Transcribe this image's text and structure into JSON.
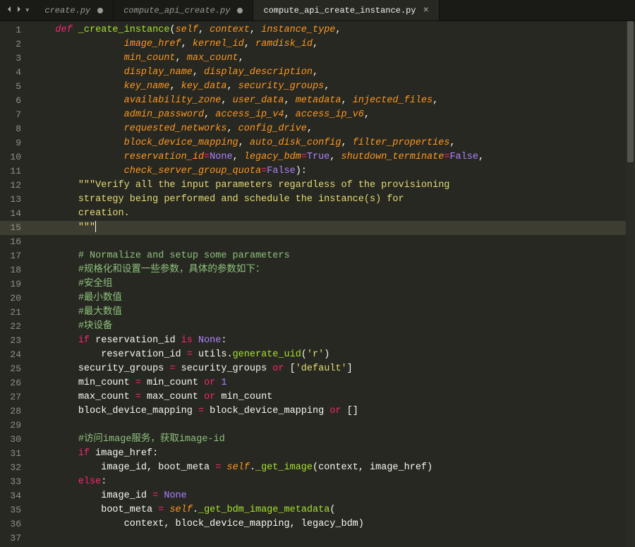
{
  "tabs": [
    {
      "label": "create.py",
      "modified": true,
      "active": false
    },
    {
      "label": "compute_api_create.py",
      "modified": true,
      "active": false
    },
    {
      "label": "compute_api_create_instance.py",
      "modified": false,
      "active": true
    }
  ],
  "line_start": 1,
  "line_end": 37,
  "current_line": 15,
  "code": {
    "l1": {
      "indent": "    ",
      "def": "def",
      "fname": "_create_instance",
      "open": "(",
      "p": [
        "self",
        "context",
        "instance_type"
      ],
      "trail": ","
    },
    "l2": {
      "indent": "                ",
      "p": [
        "image_href",
        "kernel_id",
        "ramdisk_id"
      ],
      "trail": ","
    },
    "l3": {
      "indent": "                ",
      "p": [
        "min_count",
        "max_count"
      ],
      "trail": ","
    },
    "l4": {
      "indent": "                ",
      "p": [
        "display_name",
        "display_description"
      ],
      "trail": ","
    },
    "l5": {
      "indent": "                ",
      "p": [
        "key_name",
        "key_data",
        "security_groups"
      ],
      "trail": ","
    },
    "l6": {
      "indent": "                ",
      "p": [
        "availability_zone",
        "user_data",
        "metadata",
        "injected_files"
      ],
      "trail": ","
    },
    "l7": {
      "indent": "                ",
      "p": [
        "admin_password",
        "access_ip_v4",
        "access_ip_v6"
      ],
      "trail": ","
    },
    "l8": {
      "indent": "                ",
      "p": [
        "requested_networks",
        "config_drive"
      ],
      "trail": ","
    },
    "l9": {
      "indent": "                ",
      "p": [
        "block_device_mapping",
        "auto_disk_config",
        "filter_properties"
      ],
      "trail": ","
    },
    "l10": {
      "indent": "                ",
      "kp": [
        [
          "reservation_id",
          "None"
        ],
        [
          "legacy_bdm",
          "True"
        ],
        [
          "shutdown_terminate",
          "False"
        ]
      ],
      "trail": ","
    },
    "l11": {
      "indent": "                ",
      "kp": [
        [
          "check_server_group_quota",
          "False"
        ]
      ],
      "close": "):"
    },
    "l12": {
      "indent": "        ",
      "doc": "\"\"\"Verify all the input parameters regardless of the provisioning"
    },
    "l13": {
      "indent": "        ",
      "doc": "strategy being performed and schedule the instance(s) for"
    },
    "l14": {
      "indent": "        ",
      "doc": "creation."
    },
    "l15": {
      "indent": "        ",
      "doc": "\"\"\""
    },
    "l16": {
      "blank": true
    },
    "l17": {
      "indent": "        ",
      "cmt": "# Normalize and setup some parameters"
    },
    "l18": {
      "indent": "        ",
      "cmt": "#规格化和设置一些参数，具体的参数如下："
    },
    "l19": {
      "indent": "        ",
      "cmt": "#安全组"
    },
    "l20": {
      "indent": "        ",
      "cmt": "#最小数值"
    },
    "l21": {
      "indent": "        ",
      "cmt": "#最大数值"
    },
    "l22": {
      "indent": "        ",
      "cmt": "#块设备"
    },
    "l23": {
      "indent": "        ",
      "tokens": [
        [
          "kw",
          "if"
        ],
        [
          "sp",
          " "
        ],
        [
          "t",
          "reservation_id"
        ],
        [
          "sp",
          " "
        ],
        [
          "kw",
          "is"
        ],
        [
          "sp",
          " "
        ],
        [
          "bool",
          "None"
        ],
        [
          "t",
          ":"
        ]
      ]
    },
    "l24": {
      "indent": "            ",
      "tokens": [
        [
          "t",
          "reservation_id "
        ],
        [
          "op",
          "="
        ],
        [
          "t",
          " utils."
        ],
        [
          "fn",
          "generate_uid"
        ],
        [
          "t",
          "("
        ],
        [
          "str",
          "'r'"
        ],
        [
          "t",
          ")"
        ]
      ]
    },
    "l25": {
      "indent": "        ",
      "tokens": [
        [
          "t",
          "security_groups "
        ],
        [
          "op",
          "="
        ],
        [
          "t",
          " security_groups "
        ],
        [
          "kw",
          "or"
        ],
        [
          "t",
          " ["
        ],
        [
          "str",
          "'default'"
        ],
        [
          "t",
          "]"
        ]
      ]
    },
    "l26": {
      "indent": "        ",
      "tokens": [
        [
          "t",
          "min_count "
        ],
        [
          "op",
          "="
        ],
        [
          "t",
          " min_count "
        ],
        [
          "kw",
          "or"
        ],
        [
          "sp",
          " "
        ],
        [
          "num",
          "1"
        ]
      ]
    },
    "l27": {
      "indent": "        ",
      "tokens": [
        [
          "t",
          "max_count "
        ],
        [
          "op",
          "="
        ],
        [
          "t",
          " max_count "
        ],
        [
          "kw",
          "or"
        ],
        [
          "t",
          " min_count"
        ]
      ]
    },
    "l28": {
      "indent": "        ",
      "tokens": [
        [
          "t",
          "block_device_mapping "
        ],
        [
          "op",
          "="
        ],
        [
          "t",
          " block_device_mapping "
        ],
        [
          "kw",
          "or"
        ],
        [
          "t",
          " []"
        ]
      ]
    },
    "l29": {
      "blank": true
    },
    "l30": {
      "indent": "        ",
      "cmt": "#访问image服务，获取image-id"
    },
    "l31": {
      "indent": "        ",
      "tokens": [
        [
          "kw",
          "if"
        ],
        [
          "t",
          " image_href:"
        ]
      ]
    },
    "l32": {
      "indent": "            ",
      "tokens": [
        [
          "t",
          "image_id, boot_meta "
        ],
        [
          "op",
          "="
        ],
        [
          "sp",
          " "
        ],
        [
          "self",
          "self"
        ],
        [
          "t",
          "."
        ],
        [
          "fn",
          "_get_image"
        ],
        [
          "t",
          "(context, image_href)"
        ]
      ]
    },
    "l33": {
      "indent": "        ",
      "tokens": [
        [
          "kw",
          "else"
        ],
        [
          "t",
          ":"
        ]
      ]
    },
    "l34": {
      "indent": "            ",
      "tokens": [
        [
          "t",
          "image_id "
        ],
        [
          "op",
          "="
        ],
        [
          "sp",
          " "
        ],
        [
          "bool",
          "None"
        ]
      ]
    },
    "l35": {
      "indent": "            ",
      "tokens": [
        [
          "t",
          "boot_meta "
        ],
        [
          "op",
          "="
        ],
        [
          "sp",
          " "
        ],
        [
          "self",
          "self"
        ],
        [
          "t",
          "."
        ],
        [
          "fn",
          "_get_bdm_image_metadata"
        ],
        [
          "t",
          "("
        ]
      ]
    },
    "l36": {
      "indent": "                ",
      "tokens": [
        [
          "t",
          "context, block_device_mapping, legacy_bdm)"
        ]
      ]
    },
    "l37": {
      "blank": true
    }
  }
}
